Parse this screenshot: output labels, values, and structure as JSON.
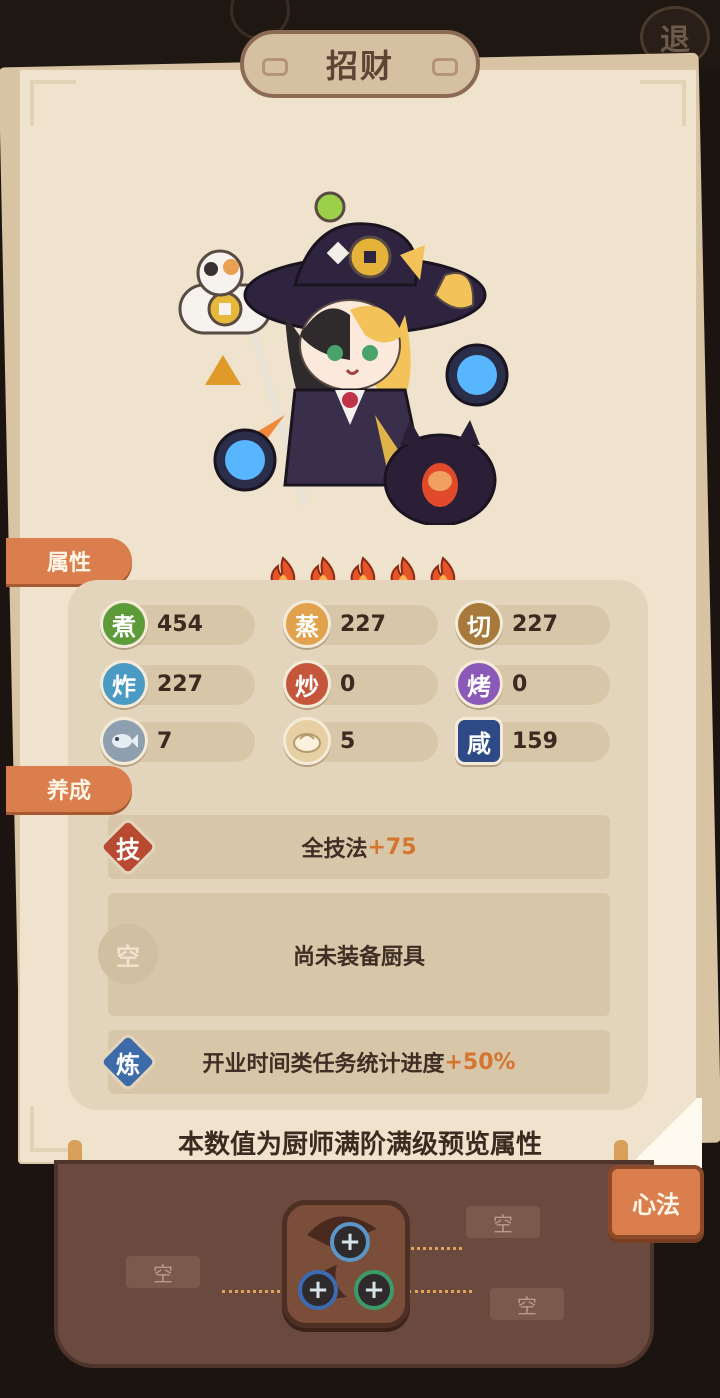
{
  "header": {
    "title": "招财",
    "exit_label": "退"
  },
  "tabs": {
    "attributes": "属性",
    "cultivation": "养成"
  },
  "rarity": {
    "flames": 5
  },
  "stats": [
    {
      "icon": "煮",
      "value": "454",
      "color": "#5c9a3a"
    },
    {
      "icon": "蒸",
      "value": "227",
      "color": "#e2a14c"
    },
    {
      "icon": "切",
      "value": "227",
      "color": "#a7793a"
    },
    {
      "icon": "炸",
      "value": "227",
      "color": "#4a9ac4"
    },
    {
      "icon": "炒",
      "value": "0",
      "color": "#c5563b"
    },
    {
      "icon": "烤",
      "value": "0",
      "color": "#8b5ab8"
    },
    {
      "icon": "fish-icon",
      "value": "7",
      "color": "#8ea0b0"
    },
    {
      "icon": "bun-icon",
      "value": "5",
      "color": "#e6cfa2"
    },
    {
      "icon": "咸",
      "value": "159",
      "color": "#2d4a86"
    }
  ],
  "growth": {
    "skill": {
      "icon": "技",
      "text": "全技法",
      "bonus": "+75"
    },
    "equipment": {
      "icon": "空",
      "text": "尚未装备厨具"
    },
    "refine": {
      "icon": "炼",
      "text": "开业时间类任务统计进度",
      "bonus": "+50%"
    }
  },
  "preview_note": "本数值为厨师满阶满级预览属性",
  "xinfa": {
    "button_label": "心法",
    "slots": [
      "空",
      "空",
      "空"
    ]
  }
}
